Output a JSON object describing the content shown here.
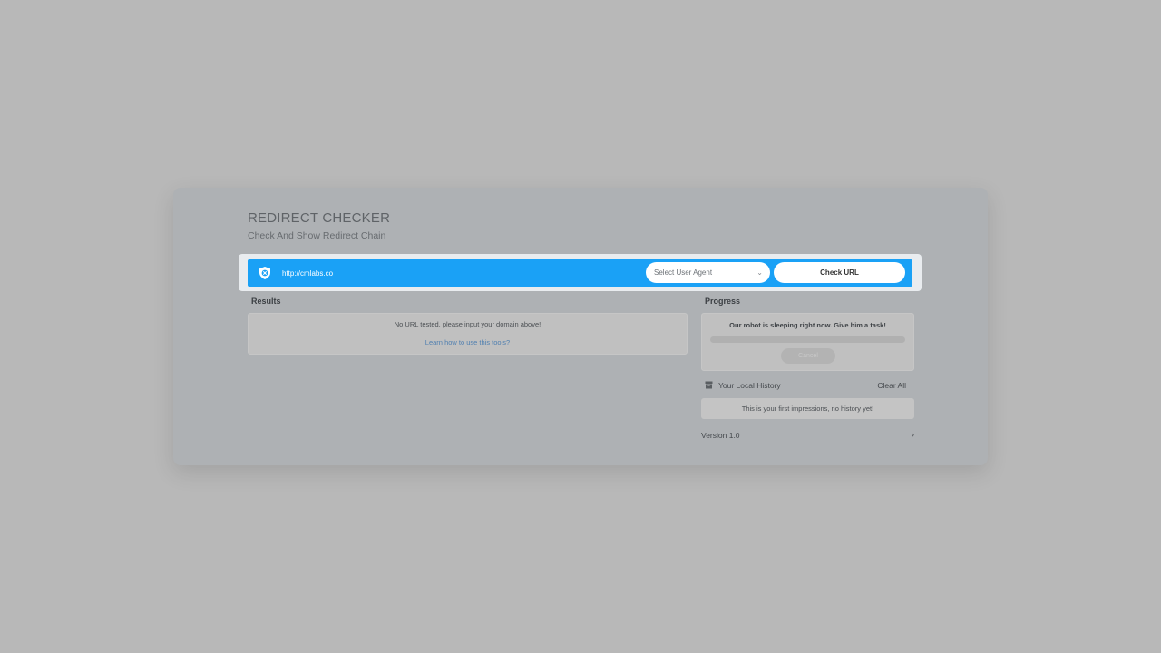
{
  "header": {
    "title": "REDIRECT CHECKER",
    "subtitle": "Check And Show Redirect Chain"
  },
  "search": {
    "url_value": "http://cmlabs.co",
    "user_agent_placeholder": "Select User Agent",
    "check_button_label": "Check URL",
    "icon": "shield-x-icon",
    "accent_color": "#1aa1f6"
  },
  "results": {
    "label": "Results",
    "empty_message": "No URL tested, please input your domain above!",
    "help_link": "Learn how to use this tools?"
  },
  "progress": {
    "label": "Progress",
    "status_message": "Our robot is sleeping right now. Give him a task!",
    "value": 0,
    "cancel_label": "Cancel"
  },
  "history": {
    "icon": "archive-box-icon",
    "title": "Your Local History",
    "clear_label": "Clear All",
    "empty_message": "This is your first impressions, no history yet!"
  },
  "footer": {
    "version": "Version 1.0",
    "chevron_icon": "chevron-right-icon"
  }
}
